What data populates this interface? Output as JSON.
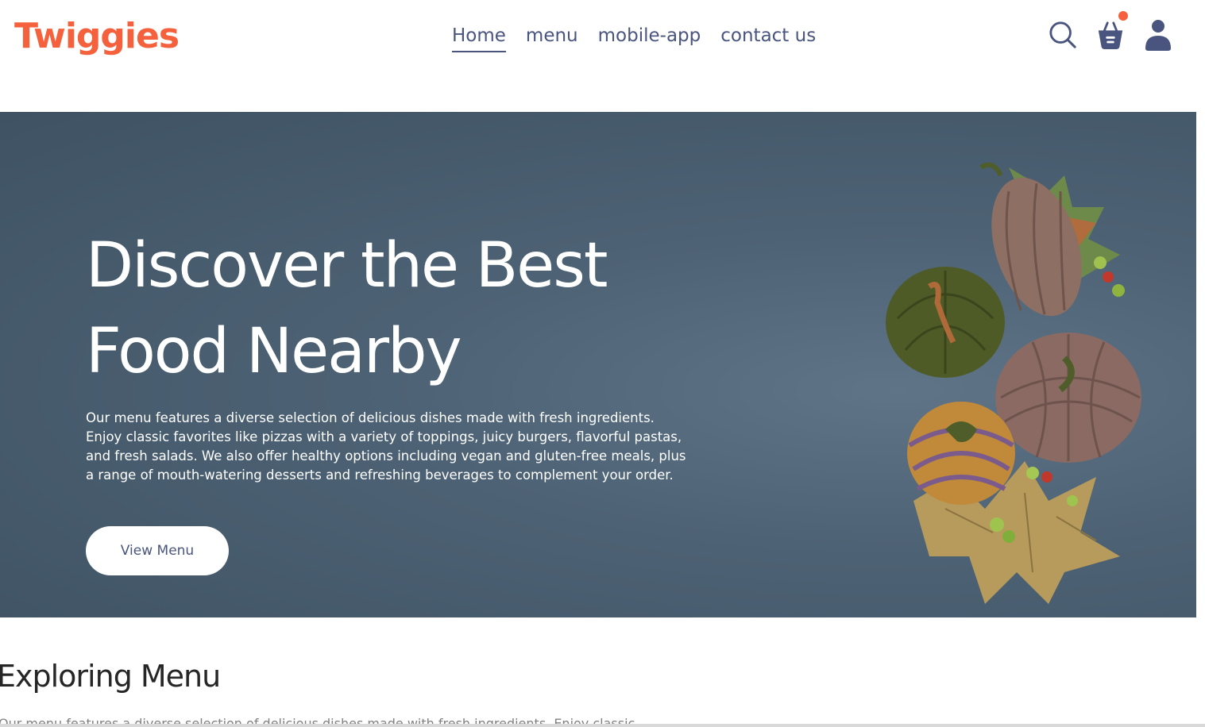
{
  "brand": {
    "logo_text": "Twiggies",
    "accent_color": "#f4613c",
    "nav_text_color": "#49557e"
  },
  "navbar": {
    "links": [
      {
        "label": "Home",
        "active": true
      },
      {
        "label": "menu",
        "active": false
      },
      {
        "label": "mobile-app",
        "active": false
      },
      {
        "label": "contact us",
        "active": false
      }
    ],
    "icons": [
      "search-icon",
      "basket-icon",
      "user-icon"
    ],
    "cart_has_items": true
  },
  "hero": {
    "title_line1": "Discover the Best",
    "title_line2": "Food Nearby",
    "description": "Our menu features a diverse selection of delicious dishes made with fresh ingredients. Enjoy classic favorites like pizzas with a variety of toppings, juicy burgers, flavorful pastas, and fresh salads. We also offer healthy options including vegan and gluten-free meals, plus a range of mouth-watering desserts and refreshing beverages to complement your order.",
    "button_label": "View Menu",
    "background_color": "#4d6274"
  },
  "explore": {
    "title": "Exploring Menu",
    "description": "Our menu features a diverse selection of delicious dishes made with fresh ingredients. Enjoy classic"
  }
}
